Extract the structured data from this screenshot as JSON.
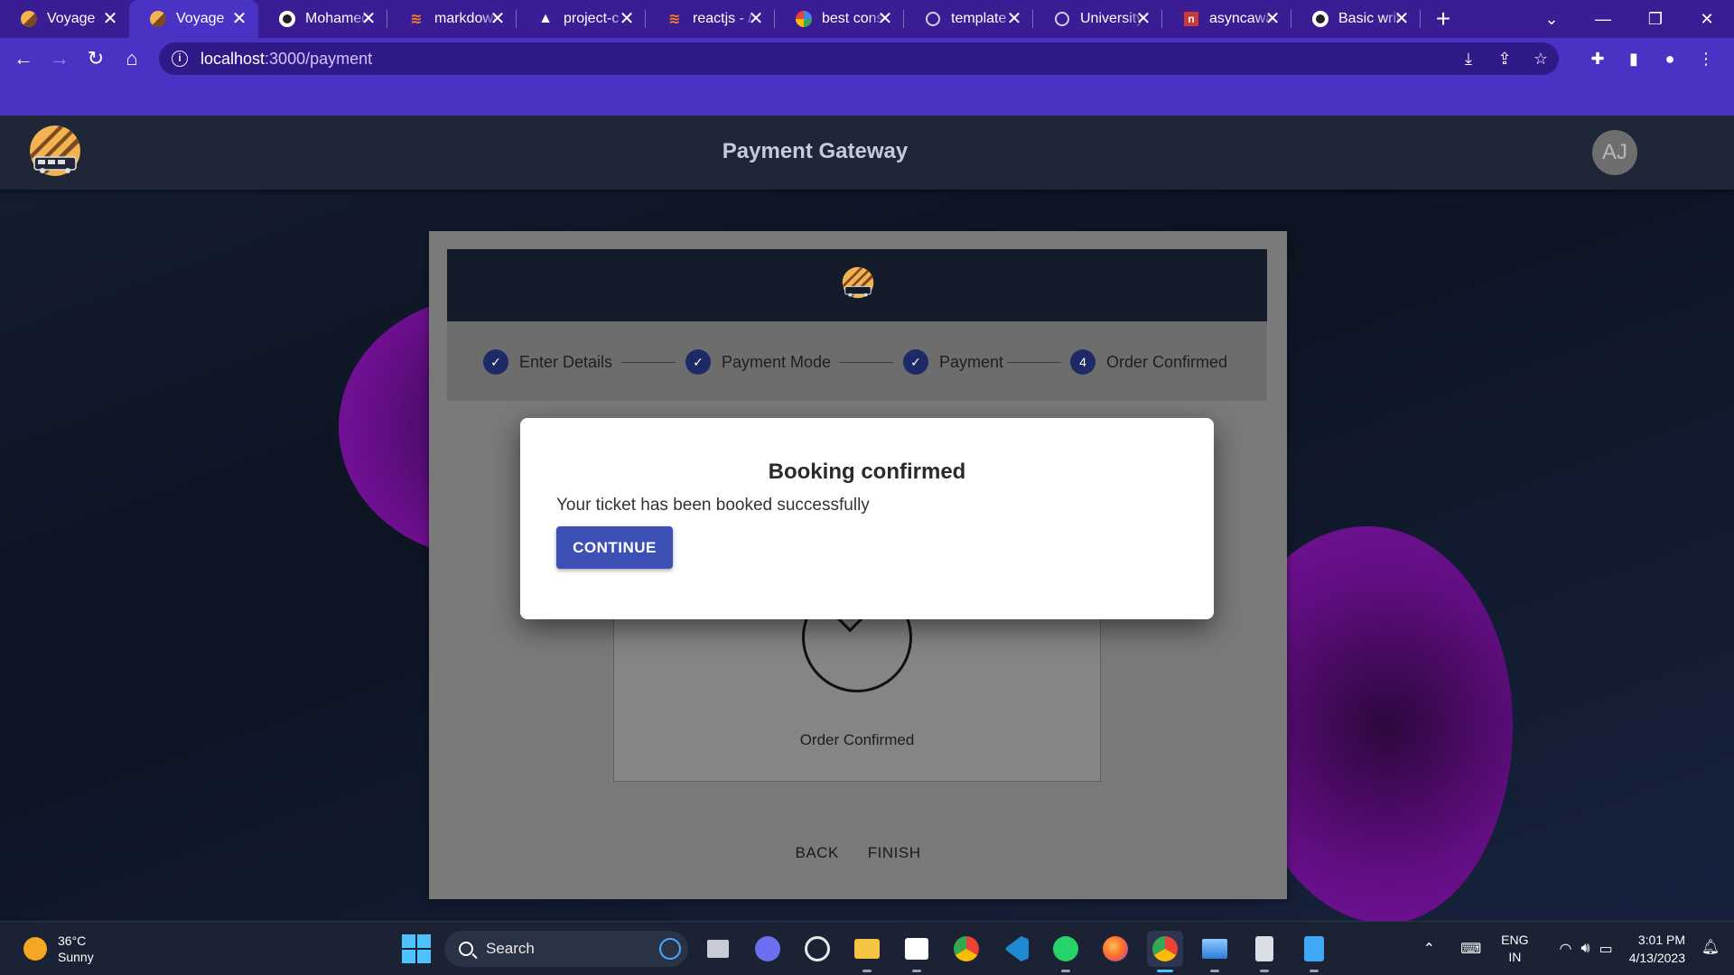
{
  "browser": {
    "tabs": [
      {
        "title": "Voyage",
        "icon": "voyage-logo",
        "active": false
      },
      {
        "title": "Voyage",
        "icon": "voyage-logo",
        "active": true
      },
      {
        "title": "Mohamed",
        "icon": "github-icon",
        "active": false
      },
      {
        "title": "markdown",
        "icon": "stackoverflow-icon",
        "active": false
      },
      {
        "title": "project-c",
        "icon": "vercel-icon",
        "active": false
      },
      {
        "title": "reactjs - /",
        "icon": "stackoverflow-icon",
        "active": false
      },
      {
        "title": "best cons",
        "icon": "google-icon",
        "active": false
      },
      {
        "title": "template",
        "icon": "globe-icon",
        "active": false
      },
      {
        "title": "University",
        "icon": "globe-icon",
        "active": false
      },
      {
        "title": "asyncawa",
        "icon": "npm-icon",
        "active": false
      },
      {
        "title": "Basic writ",
        "icon": "github-icon",
        "active": false
      }
    ],
    "tab_close_glyph": "✕",
    "new_tab_glyph": "+",
    "url_host": "localhost",
    "url_path": ":3000/payment"
  },
  "app": {
    "title": "Payment Gateway",
    "avatar_initials": "AJ"
  },
  "stepper": {
    "steps": [
      {
        "label": "Enter Details",
        "state": "done",
        "number": ""
      },
      {
        "label": "Payment Mode",
        "state": "done",
        "number": ""
      },
      {
        "label": "Payment",
        "state": "done",
        "number": ""
      },
      {
        "label": "Order Confirmed",
        "state": "current",
        "number": "4"
      }
    ]
  },
  "content": {
    "status_text": "Order Confirmed",
    "back_label": "BACK",
    "finish_label": "FINISH"
  },
  "modal": {
    "title": "Booking confirmed",
    "message": "Your ticket has been booked successfully",
    "button_label": "CONTINUE"
  },
  "taskbar": {
    "temperature": "36°C",
    "weather": "Sunny",
    "search_label": "Search",
    "lang_1": "ENG",
    "lang_2": "IN",
    "time": "3:01 PM",
    "date": "4/13/2023"
  },
  "colors": {
    "browser_frame": "#3a1c94",
    "browser_toolbar": "#4a33c4",
    "app_bar": "#1e2637",
    "step_dot": "#1e2a66",
    "primary_button": "#3d50b6",
    "blob": "#8d14b8"
  }
}
